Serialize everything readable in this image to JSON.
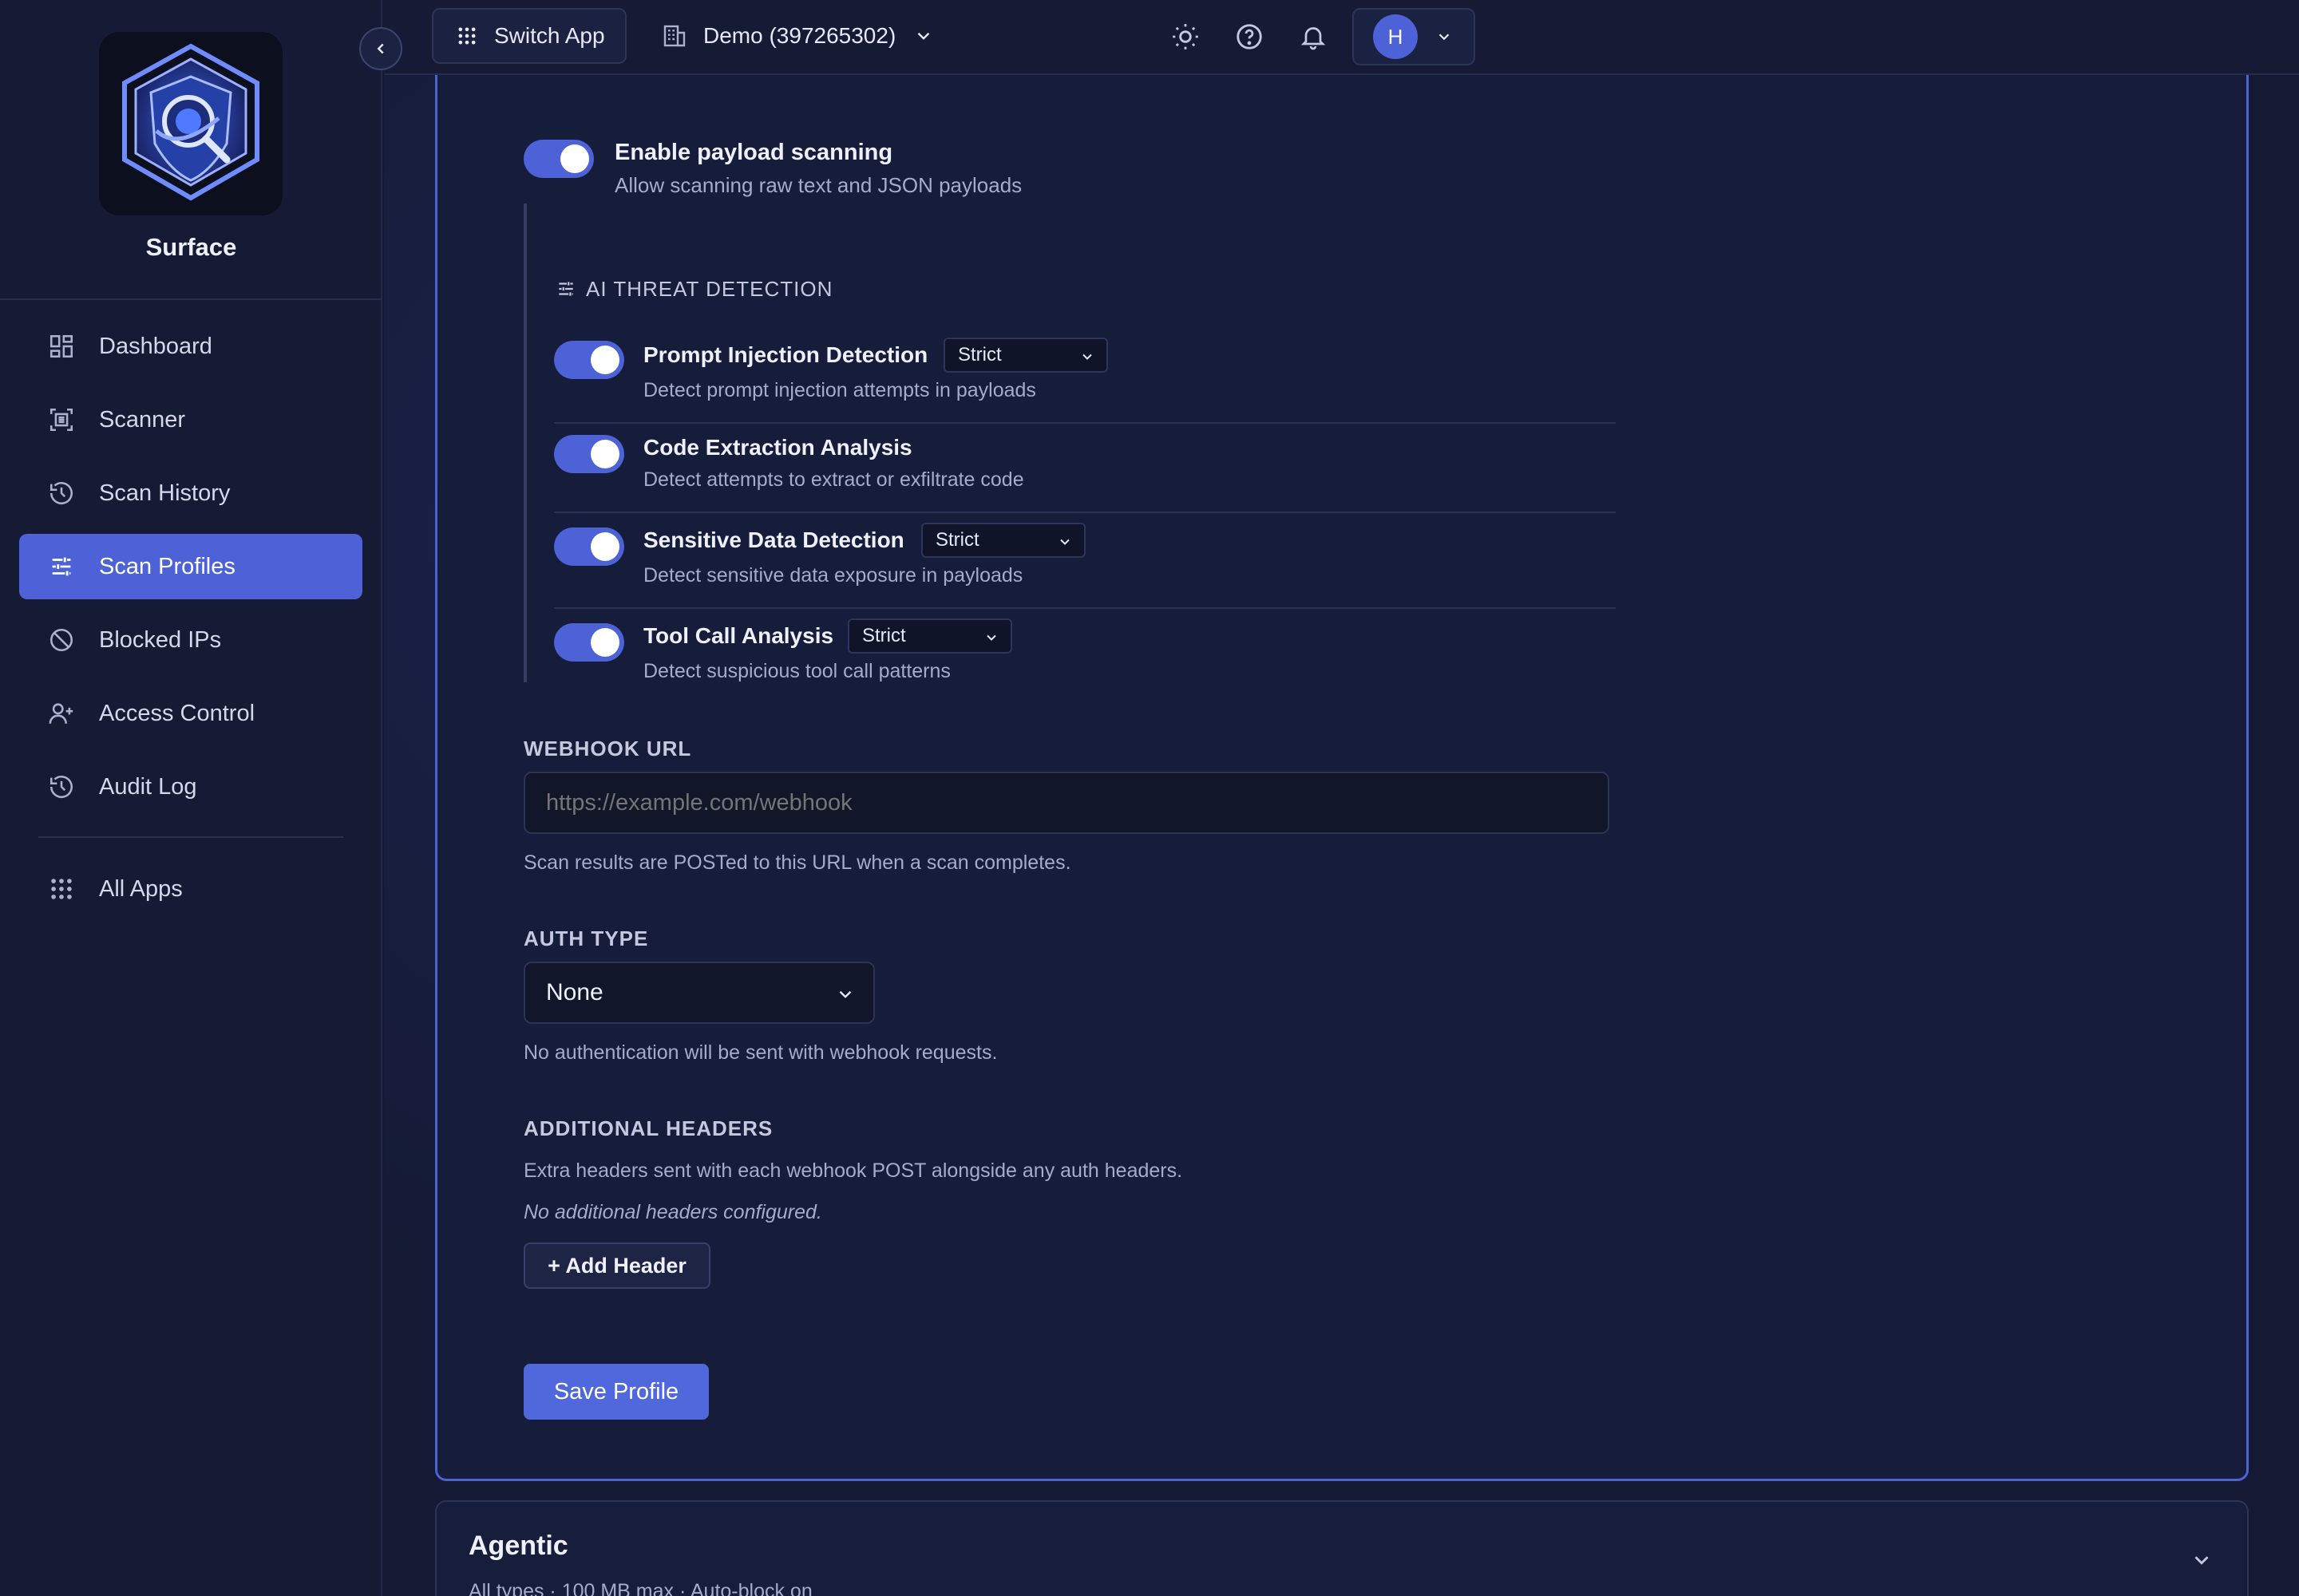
{
  "brand": {
    "name": "Surface"
  },
  "sidebar": {
    "items": [
      {
        "label": "Dashboard",
        "icon": "dashboard-icon",
        "active": false
      },
      {
        "label": "Scanner",
        "icon": "scanner-icon",
        "active": false
      },
      {
        "label": "Scan History",
        "icon": "history-icon",
        "active": false
      },
      {
        "label": "Scan Profiles",
        "icon": "sliders-icon",
        "active": true
      },
      {
        "label": "Blocked IPs",
        "icon": "blocked-icon",
        "active": false
      },
      {
        "label": "Access Control",
        "icon": "user-plus-icon",
        "active": false
      },
      {
        "label": "Audit Log",
        "icon": "history-icon",
        "active": false
      }
    ],
    "all_apps": {
      "label": "All Apps",
      "icon": "grid-icon"
    }
  },
  "topbar": {
    "switch_app": "Switch App",
    "org": "Demo (397265302)",
    "user_initial": "H"
  },
  "profile_form": {
    "payload_scanning": {
      "label": "Enable payload scanning",
      "description": "Allow scanning raw text and JSON payloads",
      "enabled": true
    },
    "ai_section": {
      "title": "AI THREAT DETECTION",
      "rows": [
        {
          "label": "Prompt Injection Detection",
          "description": "Detect prompt injection attempts in payloads",
          "level": "Strict",
          "enabled": true
        },
        {
          "label": "Code Extraction Analysis",
          "description": "Detect attempts to extract or exfiltrate code",
          "level": "",
          "enabled": true
        },
        {
          "label": "Sensitive Data Detection",
          "description": "Detect sensitive data exposure in payloads",
          "level": "Strict",
          "enabled": true
        },
        {
          "label": "Tool Call Analysis",
          "description": "Detect suspicious tool call patterns",
          "level": "Strict",
          "enabled": true
        }
      ]
    },
    "webhook": {
      "label": "WEBHOOK URL",
      "placeholder": "https://example.com/webhook",
      "help": "Scan results are POSTed to this URL when a scan completes."
    },
    "auth": {
      "label": "AUTH TYPE",
      "value": "None",
      "help": "No authentication will be sent with webhook requests."
    },
    "headers": {
      "label": "ADDITIONAL HEADERS",
      "help": "Extra headers sent with each webhook POST alongside any auth headers.",
      "empty": "No additional headers configured.",
      "add_label": "+ Add Header"
    },
    "save_label": "Save Profile"
  },
  "agentic": {
    "title": "Agentic",
    "subtitle": "All types · 100 MB max · Auto-block on"
  },
  "colors": {
    "accent": "#4c62d6",
    "background": "#141a33",
    "sidebar": "#151b34"
  }
}
